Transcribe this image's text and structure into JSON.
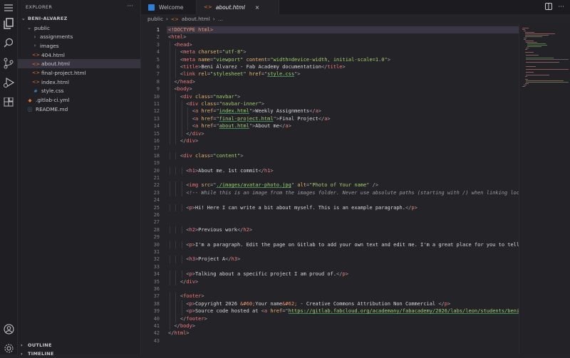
{
  "explorer": {
    "title": "EXPLORER",
    "more": "···",
    "root": "BENI-ALVAREZ",
    "items": [
      {
        "label": "public",
        "kind": "folder-open",
        "depth": 1
      },
      {
        "label": "assignments",
        "kind": "folder",
        "depth": 2
      },
      {
        "label": "images",
        "kind": "folder",
        "depth": 2
      },
      {
        "label": "404.html",
        "kind": "html",
        "depth": 2
      },
      {
        "label": "about.html",
        "kind": "html",
        "depth": 2,
        "selected": true
      },
      {
        "label": "final-project.html",
        "kind": "html",
        "depth": 2
      },
      {
        "label": "index.html",
        "kind": "html",
        "depth": 2
      },
      {
        "label": "style.css",
        "kind": "css",
        "depth": 2
      },
      {
        "label": ".gitlab-ci.yml",
        "kind": "gitlab",
        "depth": 1
      },
      {
        "label": "README.md",
        "kind": "info",
        "depth": 1
      }
    ],
    "outline": "OUTLINE",
    "timeline": "TIMELINE"
  },
  "tabs": [
    {
      "label": "Welcome"
    },
    {
      "label": "about.html",
      "close": "×"
    }
  ],
  "breadcrumb": {
    "folder": "public",
    "file": "about.html",
    "sep": "›",
    "more": "…"
  },
  "colors": {
    "accent": "#3a3646",
    "tag": "#f07a7a",
    "attr": "#e8b86a",
    "string": "#a2cf6e"
  },
  "code": {
    "current_line": 1,
    "lines": [
      "<!DOCTYPE html>",
      "<html>",
      "  <head>",
      "    <meta charset=\"utf-8\">",
      "    <meta name=\"viewport\" content=\"width=device-width, initial-scale=1.0\">",
      "    <title>Beni Álvarez - Fab Academy documentation</title>",
      "    <link rel=\"stylesheet\" href=\"style.css\">",
      "  </head>",
      "  <body>",
      "    <div class=\"navbar\">",
      "      <div class=\"navbar-inner\">",
      "        <a href=\"index.html\">Weekly Assignments</a>",
      "        <a href=\"final-project.html\">Final Project</a>",
      "        <a href=\"about.html\">About me</a>",
      "      </div>",
      "    </div>",
      "",
      "    <div class=\"content\">",
      "",
      "      <h1>About me. 1st commit</h1>",
      "",
      "      <img src=\"./images/avatar-photo.jpg\" alt=\"Photo of Your name\" />",
      "      <!-- While this is an image from the images folder. Never use absolute paths (starting with /) when linking loca",
      "",
      "      <p>Hi! Here I can write a bit about myself. This is an example paragraph.</p>",
      "",
      "",
      "      <h2>Previous work</h2>",
      "",
      "      <p>I'm a paragraph. Edit the page on Gitlab to add your own text and edit me. I'm a great place for you to tell ",
      "",
      "      <h3>Project A</h3>",
      "",
      "      <p>Talking about a specific project I am proud of.</p>",
      "    </div>",
      "",
      "    <footer>",
      "      <p>Copyright 2026 &#60;Your name&#62; - Creative Commons Attribution Non Commercial </p>",
      "      <p>Source code hosted at <a href=\"https://gitlab.fabcloud.org/academany/fabacademy/2026/labs/leon/students/beni-",
      "    </footer>",
      "  </body>",
      "</html>",
      ""
    ]
  }
}
